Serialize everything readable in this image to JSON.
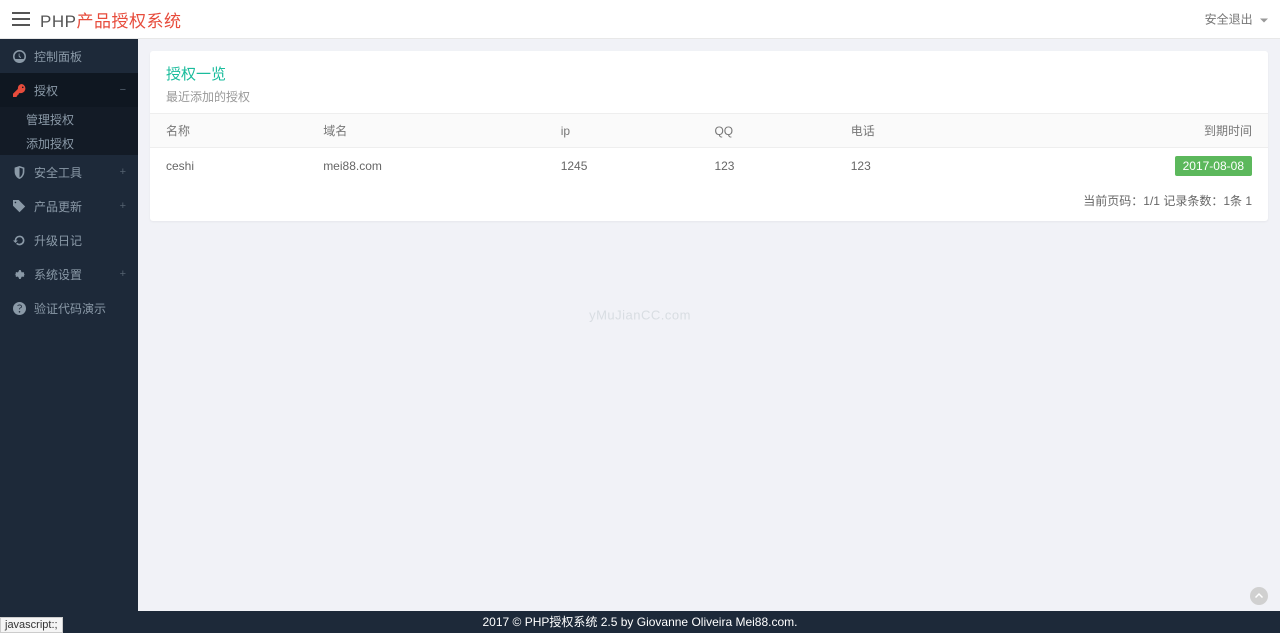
{
  "header": {
    "brand_php": "PHP",
    "brand_cn": "产品授权系统",
    "logout_label": "安全退出"
  },
  "sidebar": {
    "items": [
      {
        "label": "控制面板",
        "icon": "dashboard",
        "expandable": false
      },
      {
        "label": "授权",
        "icon": "key",
        "expandable": true,
        "active": true,
        "expand_symbol": "−",
        "sub": [
          {
            "label": "管理授权"
          },
          {
            "label": "添加授权"
          }
        ]
      },
      {
        "label": "安全工具",
        "icon": "shield",
        "expandable": true,
        "expand_symbol": "+"
      },
      {
        "label": "产品更新",
        "icon": "tags",
        "expandable": true,
        "expand_symbol": "+"
      },
      {
        "label": "升级日记",
        "icon": "refresh",
        "expandable": false
      },
      {
        "label": "系统设置",
        "icon": "cogs",
        "expandable": true,
        "expand_symbol": "+"
      },
      {
        "label": "验证代码演示",
        "icon": "question",
        "expandable": false
      }
    ]
  },
  "panel": {
    "title": "授权一览",
    "subtitle": "最近添加的授权"
  },
  "table": {
    "headers": [
      "名称",
      "域名",
      "ip",
      "QQ",
      "电话",
      "到期时间"
    ],
    "rows": [
      {
        "name": "ceshi",
        "domain": "mei88.com",
        "ip": "1245",
        "qq": "123",
        "phone": "123",
        "expire": "2017-08-08"
      }
    ]
  },
  "pagination": {
    "text": "当前页码：1/1 记录条数：1条 1"
  },
  "watermark": "yMuJianCC.com",
  "footer": "2017 © PHP授权系统 2.5 by Giovanne Oliveira Mei88.com.",
  "status_bar": "javascript:;"
}
